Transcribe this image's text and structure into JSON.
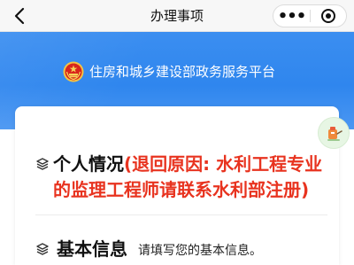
{
  "navbar": {
    "title": "办理事项",
    "back_icon": "chevron-left-icon",
    "more_label": "•••",
    "close_icon": "target-icon"
  },
  "header": {
    "platform_name": "住房和城乡建设部政务服务平台",
    "emblem_icon": "national-emblem-icon",
    "background_color": "#2f86ee"
  },
  "section_personal": {
    "title": "个人情况",
    "reason": "(退回原因: 水利工程专业的监理工程师请联系水利部注册)",
    "icon": "layers-icon"
  },
  "section_basic": {
    "title": "基本信息",
    "hint": "请填写您的基本信息。",
    "icon": "layers-icon"
  },
  "float_button": {
    "icon": "assistant-icon"
  },
  "colors": {
    "accent_red": "#e8331f",
    "primary_blue": "#2f86ee"
  }
}
